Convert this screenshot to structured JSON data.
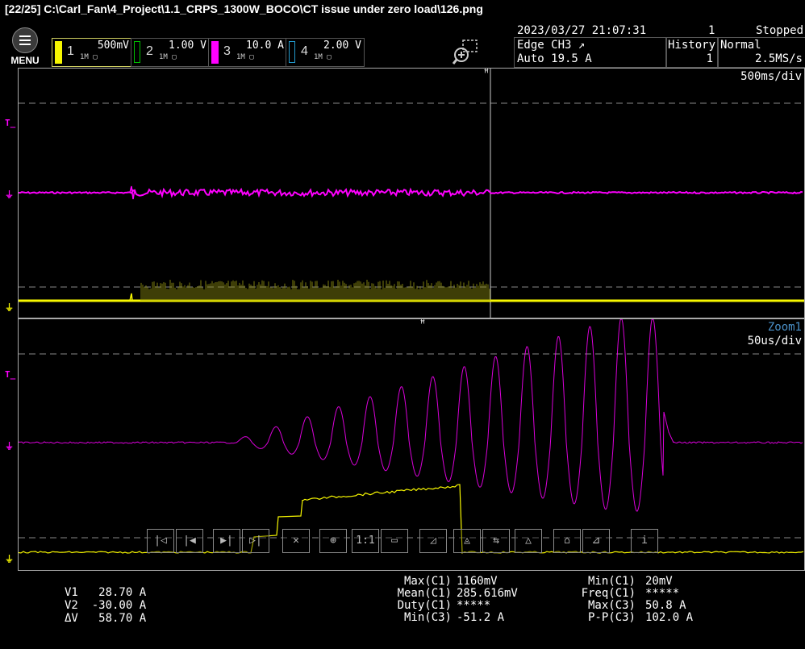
{
  "title": "[22/25]  C:\\Carl_Fan\\4_Project\\1.1_CRPS_1300W_BOCO\\CT issue under zero load\\126.png",
  "menu": {
    "label": "MENU"
  },
  "channels": [
    {
      "num": "1",
      "scale": "500mV",
      "color": "#f7f700",
      "sub": "1M ▢"
    },
    {
      "num": "2",
      "scale": "1.00 V",
      "color": "#00c000",
      "sub": "1M ▢"
    },
    {
      "num": "3",
      "scale": "10.0 A",
      "color": "#ff00ff",
      "sub": "1M ▢"
    },
    {
      "num": "4",
      "scale": "2.00 V",
      "color": "#2299cc",
      "sub": "1M ▢"
    }
  ],
  "status": {
    "datetime": "2023/03/27 21:07:31",
    "trigger_type": "Edge CH3 ↗",
    "trigger_level": "Auto 19.5 A",
    "history_label": "History",
    "history_count_top": "1",
    "history_value": "1",
    "state": "Stopped",
    "mode": "Normal",
    "sample_rate": "2.5MS/s"
  },
  "main_pane": {
    "timebase": "500ms/div"
  },
  "zoom_pane": {
    "label": "Zoom1",
    "timebase": "50us/div"
  },
  "softkeys": [
    "|◁",
    "|◀",
    "▶|",
    "▷|",
    "✕",
    "⊕",
    "1:1",
    "▭",
    "◿",
    "◬",
    "⇆",
    "△",
    "⌂",
    "⊿",
    "i"
  ],
  "cursors": {
    "v1": "V1   28.70 A",
    "v2": "V2  -30.00 A",
    "dv": "ΔV   58.70 A"
  },
  "measurements_left": [
    {
      "label": "Max(C1)",
      "value": "1160mV"
    },
    {
      "label": "Mean(C1)",
      "value": "285.616mV"
    },
    {
      "label": "Duty(C1)",
      "value": "*****"
    },
    {
      "label": "Min(C3)",
      "value": "-51.2 A"
    }
  ],
  "measurements_right": [
    {
      "label": "Min(C1)",
      "value": "20mV"
    },
    {
      "label": "Freq(C1)",
      "value": "*****"
    },
    {
      "label": "Max(C3)",
      "value": "50.8 A"
    },
    {
      "label": "P-P(C3)",
      "value": "102.0 A"
    }
  ],
  "colors": {
    "ch1": "#f7f700",
    "ch3": "#ff00ff",
    "grid": "#888888"
  }
}
